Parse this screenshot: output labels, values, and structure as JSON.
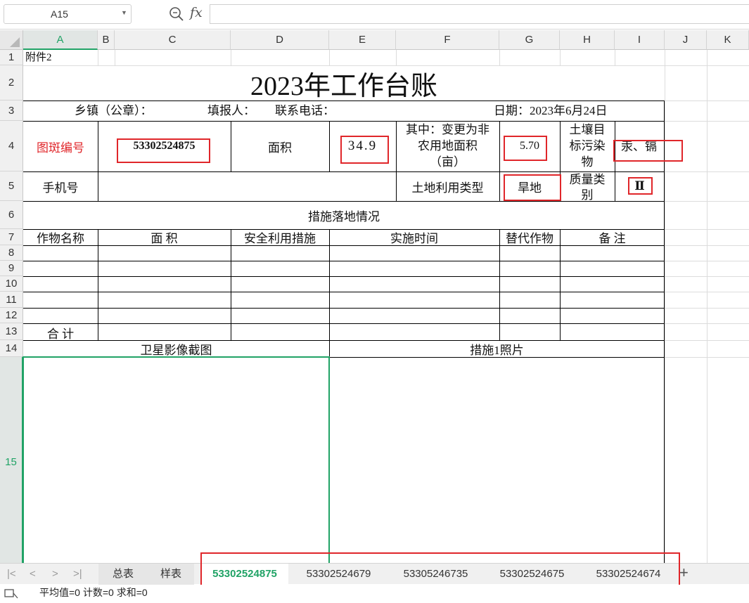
{
  "formula_bar": {
    "cell_ref": "A15",
    "fx_label": "fx",
    "formula": ""
  },
  "columns": [
    "A",
    "B",
    "C",
    "D",
    "E",
    "F",
    "G",
    "H",
    "I",
    "J",
    "K"
  ],
  "rows": [
    "1",
    "2",
    "3",
    "4",
    "5",
    "6",
    "7",
    "8",
    "9",
    "10",
    "11",
    "12",
    "13",
    "14",
    "15"
  ],
  "selected_column": "A",
  "selected_row": "15",
  "sheet": {
    "annex": "附件2",
    "title": "2023年工作台账",
    "row3": {
      "township": "乡镇（公章）：",
      "filler": "填报人：",
      "phone": "联系电话：",
      "date": "日期：2023年6月24日"
    },
    "row4": {
      "plot_id_label": "图斑编号",
      "plot_id_value": "53302524875",
      "area_label": "面积",
      "area_value": "34.9",
      "changed_label_1": "其中：变更为非",
      "changed_label_2": "农用地面积",
      "changed_label_3": "（亩）",
      "changed_value": "5.70",
      "pollutant_label_1": "土壤目",
      "pollutant_label_2": "标污染",
      "pollutant_label_3": "物",
      "pollutant_value": "汞、镉"
    },
    "row5": {
      "mobile_label": "手机号",
      "mobile_value": "",
      "landuse_label": "土地利用类型",
      "landuse_value": "旱地",
      "quality_label_1": "质量类",
      "quality_label_2": "别",
      "quality_value": "Ⅱ"
    },
    "row6": {
      "section_title": "措施落地情况"
    },
    "table_headers": [
      "作物名称",
      "面  积",
      "安全利用措施",
      "实施时间",
      "替代作物",
      "备  注"
    ],
    "table_rows": [
      [
        "",
        "",
        "",
        "",
        "",
        ""
      ],
      [
        "",
        "",
        "",
        "",
        "",
        ""
      ],
      [
        "",
        "",
        "",
        "",
        "",
        ""
      ],
      [
        "",
        "",
        "",
        "",
        "",
        ""
      ],
      [
        "",
        "",
        "",
        "",
        "",
        ""
      ]
    ],
    "total_label": "合  计",
    "row14": {
      "satellite_label": "卫星影像截图",
      "photo_label": "措施1照片"
    }
  },
  "sheet_tabs": {
    "tabs": [
      "总表",
      "样表",
      "53302524875",
      "53302524679",
      "53305246735",
      "53302524675",
      "53302524674"
    ],
    "active": "53302524875"
  },
  "status_bar": {
    "text": "平均值=0  计数=0  求和=0"
  },
  "colors": {
    "accent": "#21a366",
    "highlight_red": "#e0262a",
    "label_red": "#e0262a"
  }
}
